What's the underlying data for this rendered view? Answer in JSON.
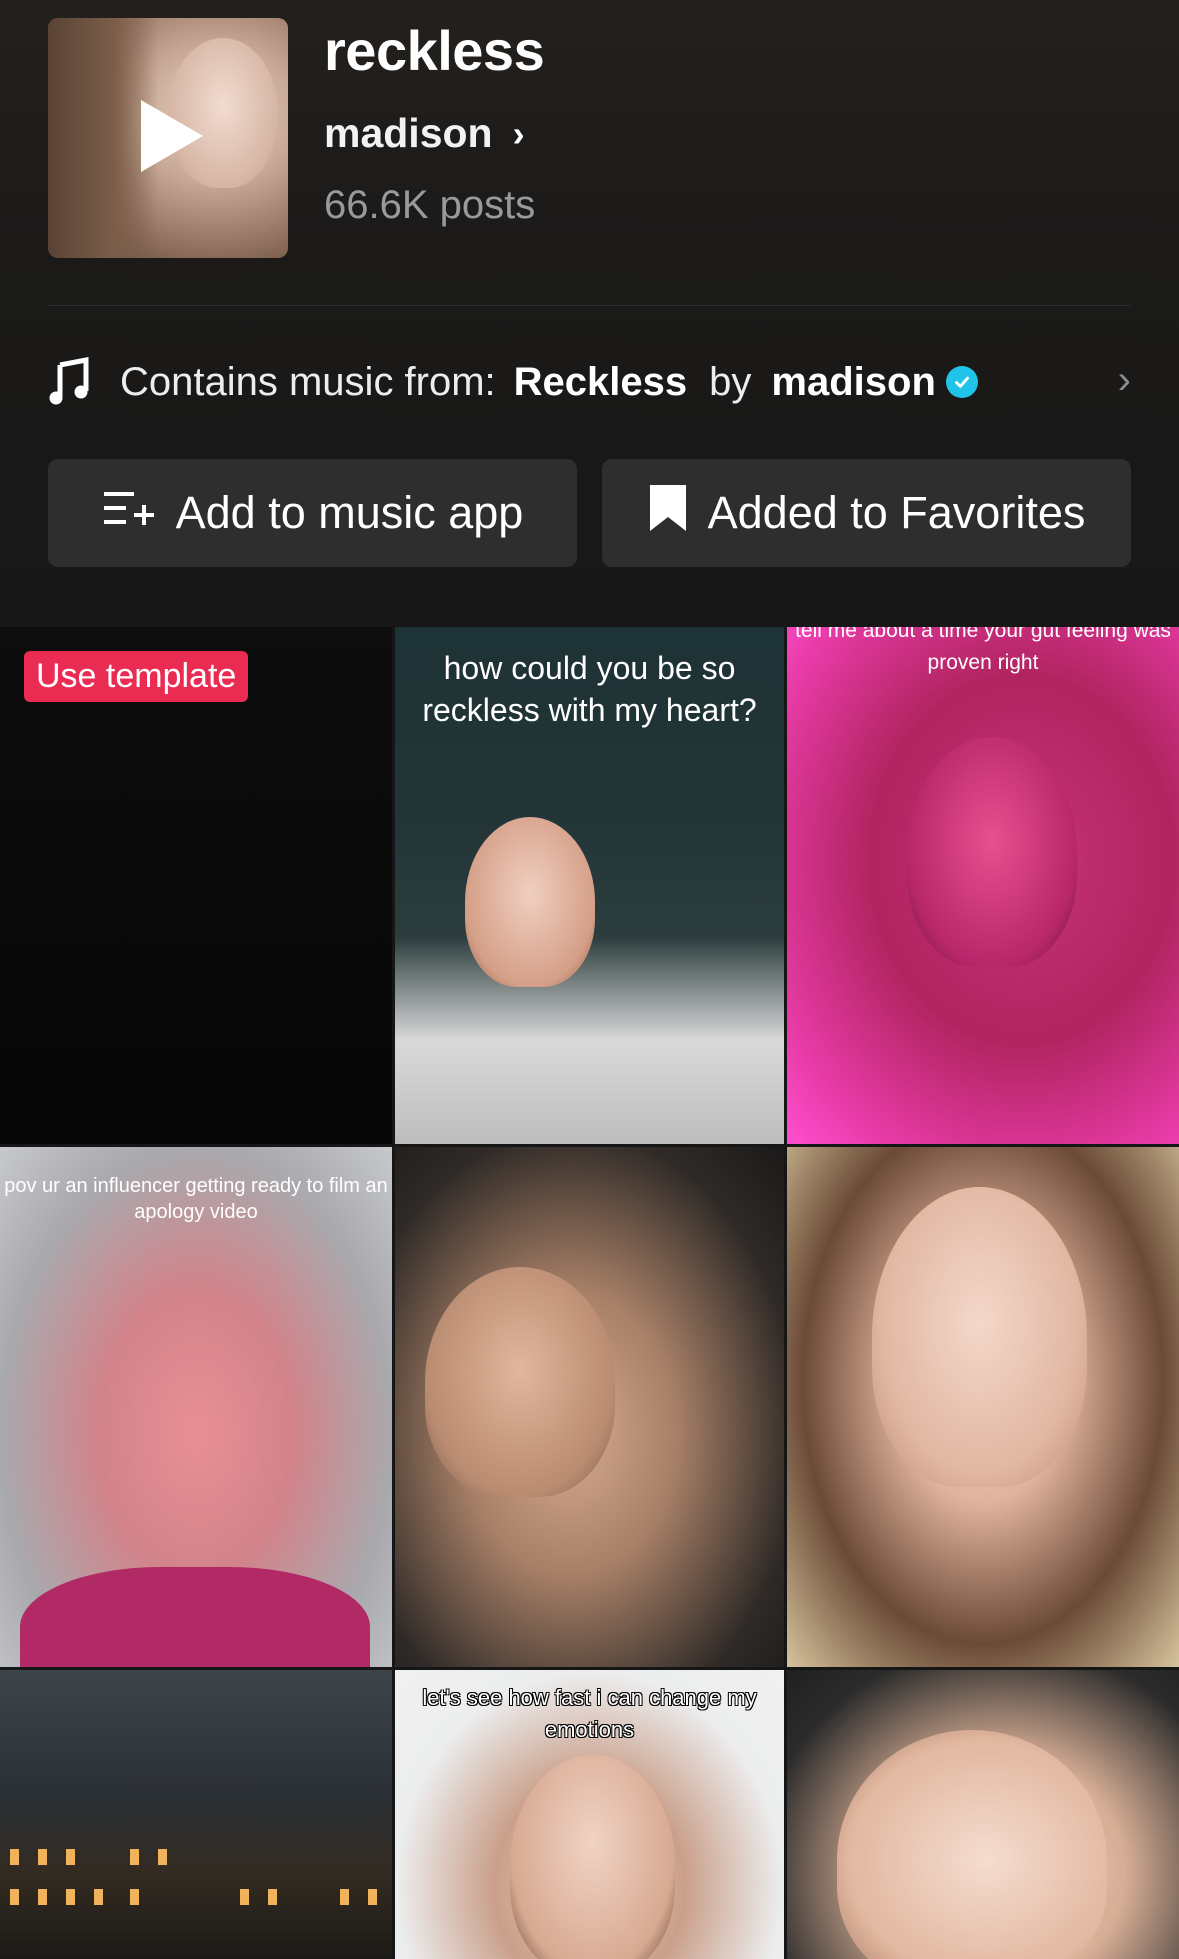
{
  "sound": {
    "title": "reckless",
    "artist": "madison",
    "posts": "66.6K posts"
  },
  "music_row": {
    "label": "Contains music from:",
    "song": "Reckless",
    "by": "by",
    "artist": "madison"
  },
  "buttons": {
    "add_music": "Add to music app",
    "favorites": "Added to Favorites"
  },
  "grid": {
    "badge": "Use template",
    "captions": {
      "c2": "how could you be so reckless with my heart?",
      "c3": "tell me about a time your gut feeling was proven right",
      "c4": "pov ur an influencer getting ready to film an apology video",
      "c8": "let's see how fast i can change my emotions"
    }
  },
  "colors": {
    "background": "#161616",
    "button": "#2e2e2e",
    "badge": "#ea2c53",
    "verified": "#20c4e8"
  },
  "icons": [
    "play-icon",
    "chevron-right-icon",
    "music-note-icon",
    "verified-icon",
    "add-to-playlist-icon",
    "bookmark-icon"
  ]
}
